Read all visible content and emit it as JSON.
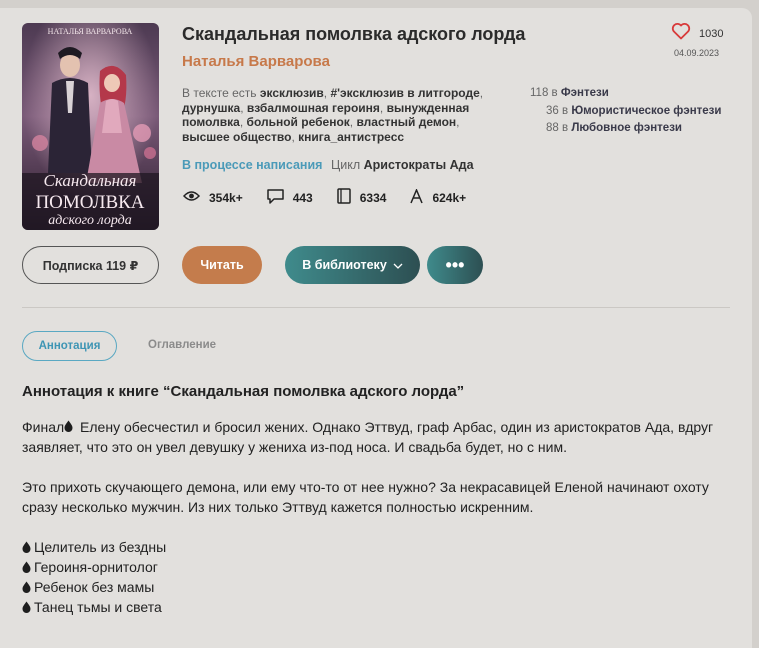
{
  "book": {
    "title": "Скандальная помолвка адского лорда",
    "author": "Наталья Варварова",
    "likes": "1030",
    "date": "04.09.2023",
    "cover": {
      "author_text": "НАТАЛЬЯ ВАРВАРОВА",
      "title_line1": "Скандальная",
      "title_line2": "ПОМОЛВКА",
      "title_line3": "адского лорда"
    },
    "tags_prefix": "В тексте есть",
    "tags": [
      "эксклюзив",
      "#'эксклюзив в литгороде",
      "дурнушка",
      "взбалмошная героиня",
      "вынужденная помолвка",
      "больной ребенок",
      "властный демон",
      "высшее общество",
      "книга_антистресс"
    ],
    "ratings": [
      {
        "rank": "118",
        "in": "в",
        "genre": "Фэнтези"
      },
      {
        "rank": "36",
        "in": "в",
        "genre": "Юмористическое фэнтези"
      },
      {
        "rank": "88",
        "in": "в",
        "genre": "Любовное фэнтези"
      }
    ],
    "status": "В процессе написания",
    "cycle_label": "Цикл",
    "cycle_name": "Аристократы Ада",
    "stats": {
      "views": "354k+",
      "comments": "443",
      "pages": "6334",
      "chars": "624k+"
    }
  },
  "buttons": {
    "subscribe": "Подписка 119 ₽",
    "read": "Читать",
    "library": "В библиотеку",
    "more": "•••"
  },
  "tabs": {
    "annotation": "Аннотация",
    "contents": "Оглавление"
  },
  "annotation": {
    "heading": "Аннотация к книге “Скандальная помолвка адского лорда”",
    "p1_start": "Финал",
    "p1_rest": " Елену обесчестил и бросил жених. Однако Эттвуд, граф Арбас, один из аристократов Ада, вдруг заявляет, что это он увел девушку у жениха из-под носа. И свадьба будет, но с ним.",
    "p2": "Это прихоть скучающего демона, или ему что-то от нее нужно? За некрасавицей Еленой начинают охоту сразу несколько мужчин. Из них только Эттвуд кажется полностью искренним.",
    "list": [
      "Целитель из бездны",
      "Героиня-орнитолог",
      "Ребенок без мамы",
      "Танец тьмы и света"
    ]
  },
  "colors": {
    "accent_orange": "#c47c4c",
    "accent_teal": "#3f8b8c",
    "link_blue": "#4b9ab8",
    "heart": "#d83a3a"
  }
}
